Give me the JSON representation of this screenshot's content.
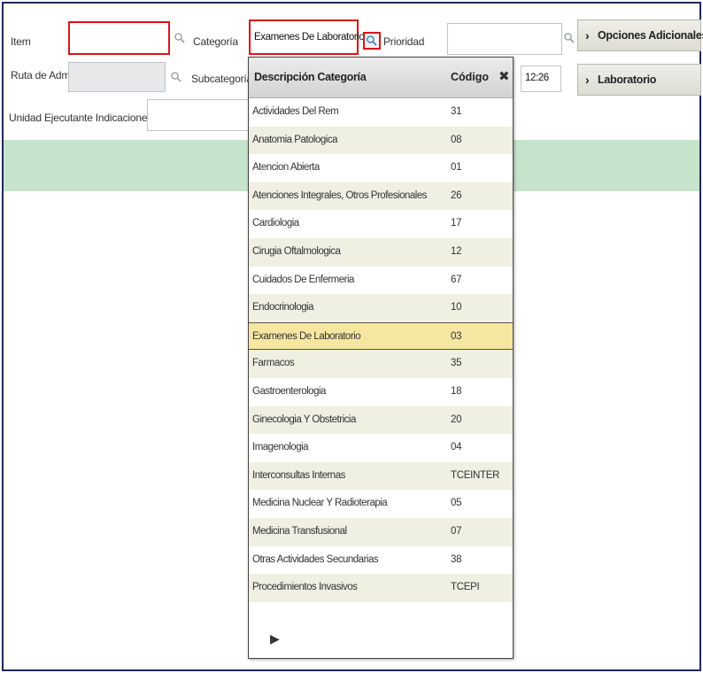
{
  "form": {
    "item_label": "Item",
    "categoria_label": "Categoría",
    "categoria_value": "Examenes De Laboratorio",
    "prioridad_label": "Prioridad",
    "ruta_label": "Ruta de Adm",
    "subcategoria_label": "Subcategoría",
    "hora_value": "12:26",
    "unidad_label": "Unidad Ejecutante Indicaciones"
  },
  "buttons": {
    "opciones_label": "Opciones Adicionales",
    "laboratorio_label": "Laboratorio",
    "chevron": "›"
  },
  "dropdown": {
    "header_desc": "Descripción Categoría",
    "header_code": "Código",
    "close_glyph": "✖",
    "next_glyph": "▶",
    "rows": [
      {
        "desc": "Actividades Del Rem",
        "code": "31"
      },
      {
        "desc": "Anatomia Patologica",
        "code": "08"
      },
      {
        "desc": "Atencion Abierta",
        "code": "01"
      },
      {
        "desc": "Atenciones Integrales, Otros Profesionales",
        "code": "26"
      },
      {
        "desc": "Cardiologia",
        "code": "17"
      },
      {
        "desc": "Cirugia Oftalmologica",
        "code": "12"
      },
      {
        "desc": "Cuidados De Enfermeria",
        "code": "67"
      },
      {
        "desc": "Endocrinologia",
        "code": "10"
      },
      {
        "desc": "Examenes De Laboratorio",
        "code": "03"
      },
      {
        "desc": "Farmacos",
        "code": "35"
      },
      {
        "desc": "Gastroenterologia",
        "code": "18"
      },
      {
        "desc": "Ginecologia Y Obstetricia",
        "code": "20"
      },
      {
        "desc": "Imagenologia",
        "code": "04"
      },
      {
        "desc": "Interconsultas Internas",
        "code": "TCEINTER"
      },
      {
        "desc": "Medicina Nuclear Y Radioterapia",
        "code": "05"
      },
      {
        "desc": "Medicina Transfusional",
        "code": "07"
      },
      {
        "desc": "Otras Actividades Secundarias",
        "code": "38"
      },
      {
        "desc": "Procedimientos Invasivos",
        "code": "TCEPI"
      }
    ],
    "selected_index": 8
  },
  "colors": {
    "highlight_red": "#d8141a",
    "selected_row": "#f5e7a2",
    "green_band": "#c6e3cc",
    "frame": "#1c2b58"
  },
  "icons": {
    "search": "magnifier-icon",
    "close": "close-icon",
    "next": "next-page-icon"
  }
}
